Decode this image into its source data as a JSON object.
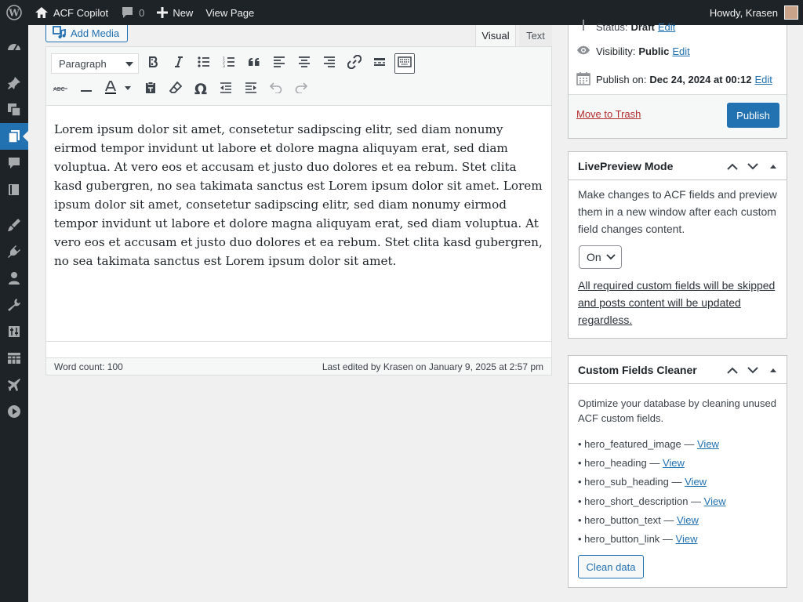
{
  "adminbar": {
    "site_name": "ACF Copilot",
    "comments_count": "0",
    "new_label": "New",
    "view_page_label": "View Page",
    "howdy": "Howdy, Krasen"
  },
  "editor": {
    "add_media_label": "Add Media",
    "tab_visual": "Visual",
    "tab_text": "Text",
    "format_value": "Paragraph",
    "content": "Lorem ipsum dolor sit amet, consetetur sadipscing elitr, sed diam nonumy eirmod tempor invidunt ut labore et dolore magna aliquyam erat, sed diam voluptua. At vero eos et accusam et justo duo dolores et ea rebum. Stet clita kasd gubergren, no sea takimata sanctus est Lorem ipsum dolor sit amet. Lorem ipsum dolor sit amet, consetetur sadipscing elitr, sed diam nonumy eirmod tempor invidunt ut labore et dolore magna aliquyam erat, sed diam voluptua. At vero eos et accusam et justo duo dolores et ea rebum. Stet clita kasd gubergren, no sea takimata sanctus est Lorem ipsum dolor sit amet.",
    "word_count": "Word count: 100",
    "last_edited": "Last edited by Krasen on January 9, 2025 at 2:57 pm"
  },
  "publish": {
    "status_label": "Status:",
    "status_value": "Draft",
    "visibility_label": "Visibility:",
    "visibility_value": "Public",
    "publish_on_label": "Publish on:",
    "publish_on_value": "Dec 24, 2024 at 00:12",
    "edit_label": "Edit",
    "trash_label": "Move to Trash",
    "publish_button": "Publish"
  },
  "livepreview": {
    "title": "LivePreview Mode",
    "description": "Make changes to ACF fields and preview them in a new window after each custom field changes content.",
    "select_value": "On",
    "note": "All required custom fields will be skipped and posts content will be updated regardless."
  },
  "cleaner": {
    "title": "Custom Fields Cleaner",
    "description": "Optimize your database by cleaning unused ACF custom fields.",
    "view_label": "View",
    "fields": [
      "hero_featured_image",
      "hero_heading",
      "hero_sub_heading",
      "hero_short_description",
      "hero_button_text",
      "hero_button_link"
    ],
    "clean_button": "Clean data"
  },
  "colors": {
    "admin_dark": "#1d2327",
    "accent": "#2271b1",
    "danger": "#b32d2e"
  }
}
